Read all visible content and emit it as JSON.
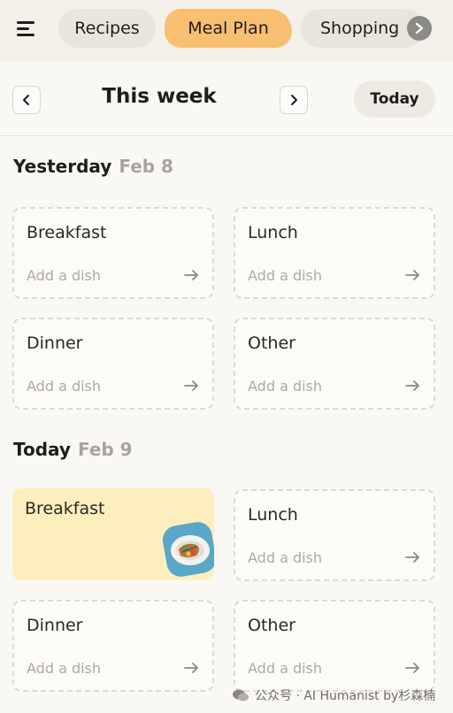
{
  "tabs": [
    {
      "label": "Recipes"
    },
    {
      "label": "Meal Plan",
      "active": true
    },
    {
      "label": "Shopping"
    }
  ],
  "icons": {
    "menu": "menu-icon",
    "more": "chevron-right-icon",
    "prev": "chevron-left-icon",
    "next": "chevron-right-icon",
    "arrow": "arrow-right-icon"
  },
  "colors": {
    "active_tab": "#f8bf72",
    "filled_card": "#fdeebe",
    "background": "#faf8f4"
  },
  "week": {
    "title": "This week",
    "today_label": "Today"
  },
  "days": [
    {
      "name": "Yesterday",
      "date": "Feb 8",
      "meals": [
        {
          "label": "Breakfast",
          "action": "Add a dish"
        },
        {
          "label": "Lunch",
          "action": "Add a dish"
        },
        {
          "label": "Dinner",
          "action": "Add a dish"
        },
        {
          "label": "Other",
          "action": "Add a dish"
        }
      ]
    },
    {
      "name": "Today",
      "date": "Feb 9",
      "meals": [
        {
          "label": "Breakfast",
          "filled": true
        },
        {
          "label": "Lunch",
          "action": "Add a dish"
        },
        {
          "label": "Dinner",
          "action": "Add a dish"
        },
        {
          "label": "Other",
          "action": "Add a dish"
        }
      ]
    }
  ],
  "watermark": "公众号 · AI Humanist by杉森楠"
}
